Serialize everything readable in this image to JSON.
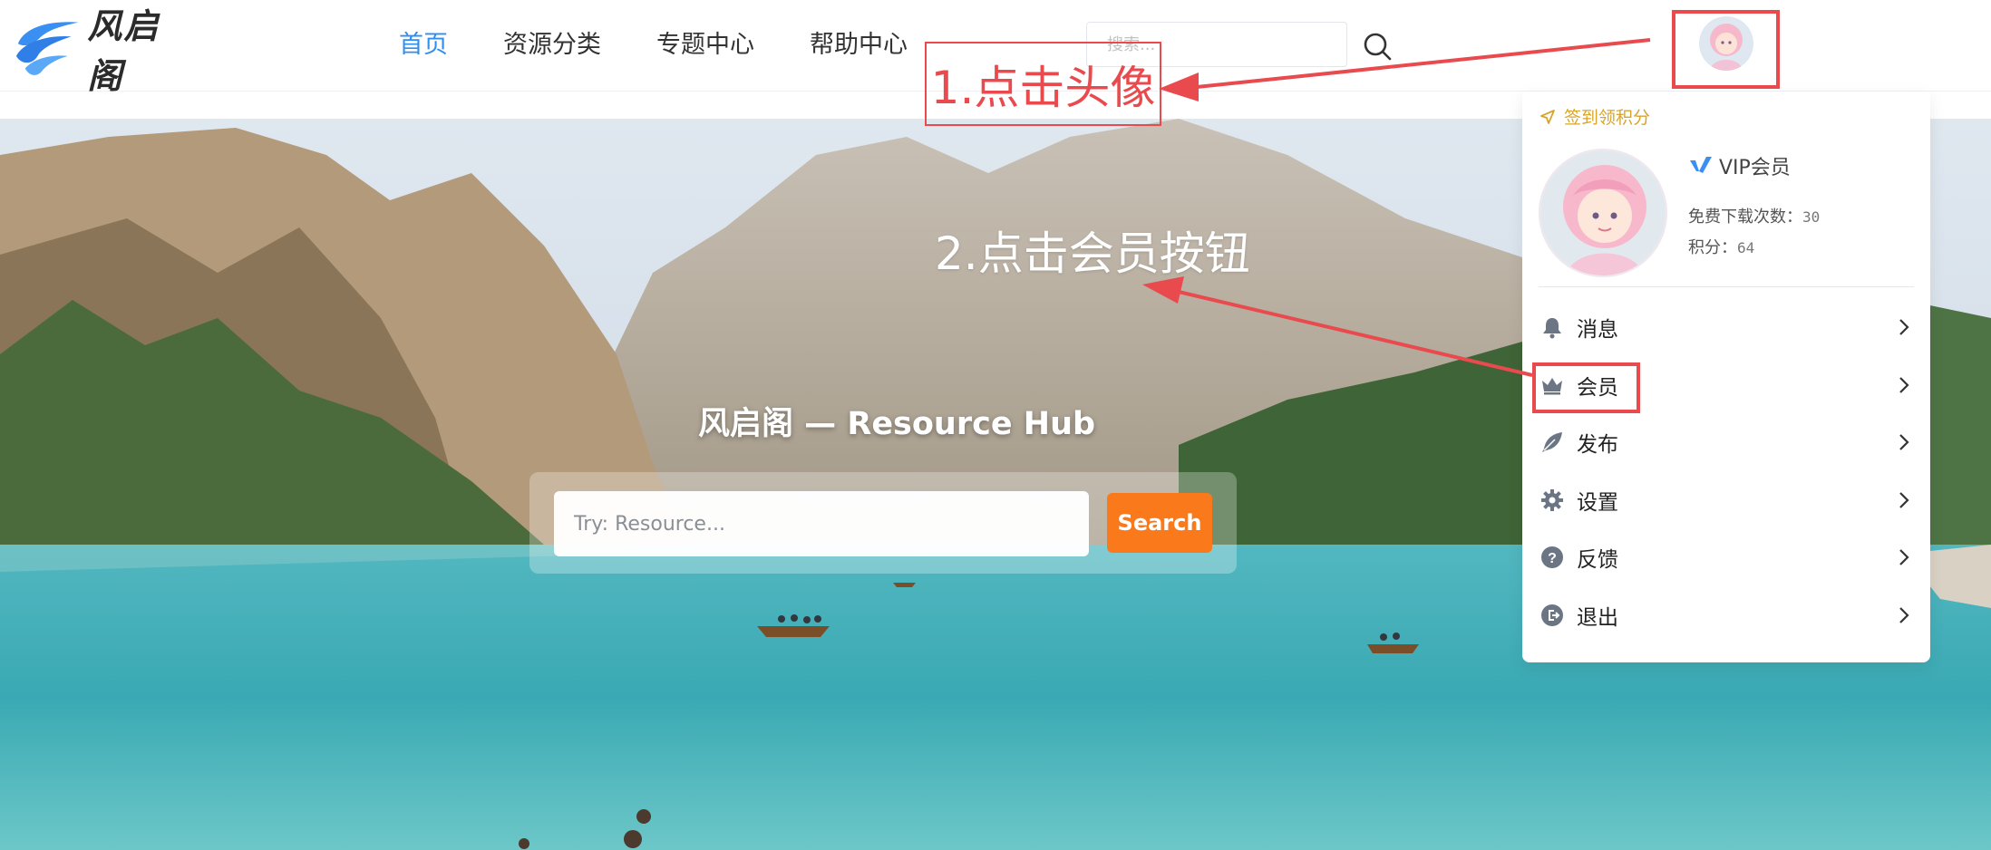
{
  "header": {
    "logo_text": "风启阁",
    "nav": [
      "首页",
      "资源分类",
      "专题中心",
      "帮助中心"
    ],
    "search_placeholder": "搜索..."
  },
  "hero": {
    "title": "风启阁 — Resource Hub",
    "search_placeholder": "Try: Resource...",
    "search_button": "Search"
  },
  "dropdown": {
    "sign_in_label": "签到领积分",
    "vip_label": "VIP会员",
    "downloads_label": "免费下载次数：",
    "downloads_value": "30",
    "points_label": "积分：",
    "points_value": "64",
    "menu": [
      {
        "label": "消息",
        "icon": "bell-icon"
      },
      {
        "label": "会员",
        "icon": "crown-icon"
      },
      {
        "label": "发布",
        "icon": "feather-icon"
      },
      {
        "label": "设置",
        "icon": "gear-icon"
      },
      {
        "label": "反馈",
        "icon": "question-icon"
      },
      {
        "label": "退出",
        "icon": "logout-icon"
      }
    ]
  },
  "annotations": {
    "step1": "1.点击头像",
    "step2": "2.点击会员按钮"
  },
  "colors": {
    "accent": "#2f8ff0",
    "search_button": "#fa7a1b",
    "annotation": "#e84a4e",
    "gold": "#d8a52a"
  }
}
